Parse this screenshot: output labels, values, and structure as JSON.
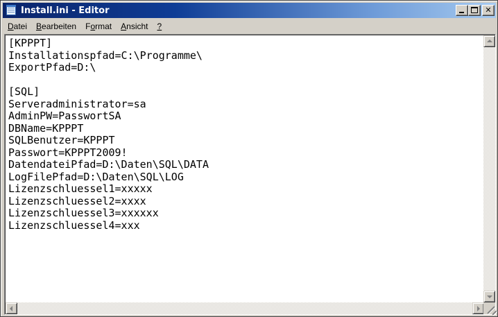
{
  "window": {
    "title": "Install.ini - Editor"
  },
  "menu": {
    "items": [
      {
        "accel": "D",
        "rest": "atei"
      },
      {
        "accel": "B",
        "rest": "earbeiten"
      },
      {
        "pre": "F",
        "accel": "o",
        "rest": "rmat"
      },
      {
        "accel": "A",
        "rest": "nsicht"
      },
      {
        "accel": "?",
        "rest": ""
      }
    ]
  },
  "editor": {
    "lines": [
      "[KPPPT]",
      "Installationspfad=C:\\Programme\\",
      "ExportPfad=D:\\",
      "",
      "[SQL]",
      "Serveradministrator=sa",
      "AdminPW=PasswortSA",
      "DBName=KPPPT",
      "SQLBenutzer=KPPPT",
      "Passwort=KPPPT2009!",
      "DatendateiPfad=D:\\Daten\\SQL\\DATA",
      "LogFilePfad=D:\\Daten\\SQL\\LOG",
      "Lizenzschluessel1=xxxxx",
      "Lizenzschluessel2=xxxx",
      "Lizenzschluessel3=xxxxxx",
      "Lizenzschluessel4=xxx"
    ]
  },
  "icons": {
    "app": "notepad-icon",
    "minimize": "minimize-icon",
    "maximize": "maximize-icon",
    "close": "close-icon"
  }
}
